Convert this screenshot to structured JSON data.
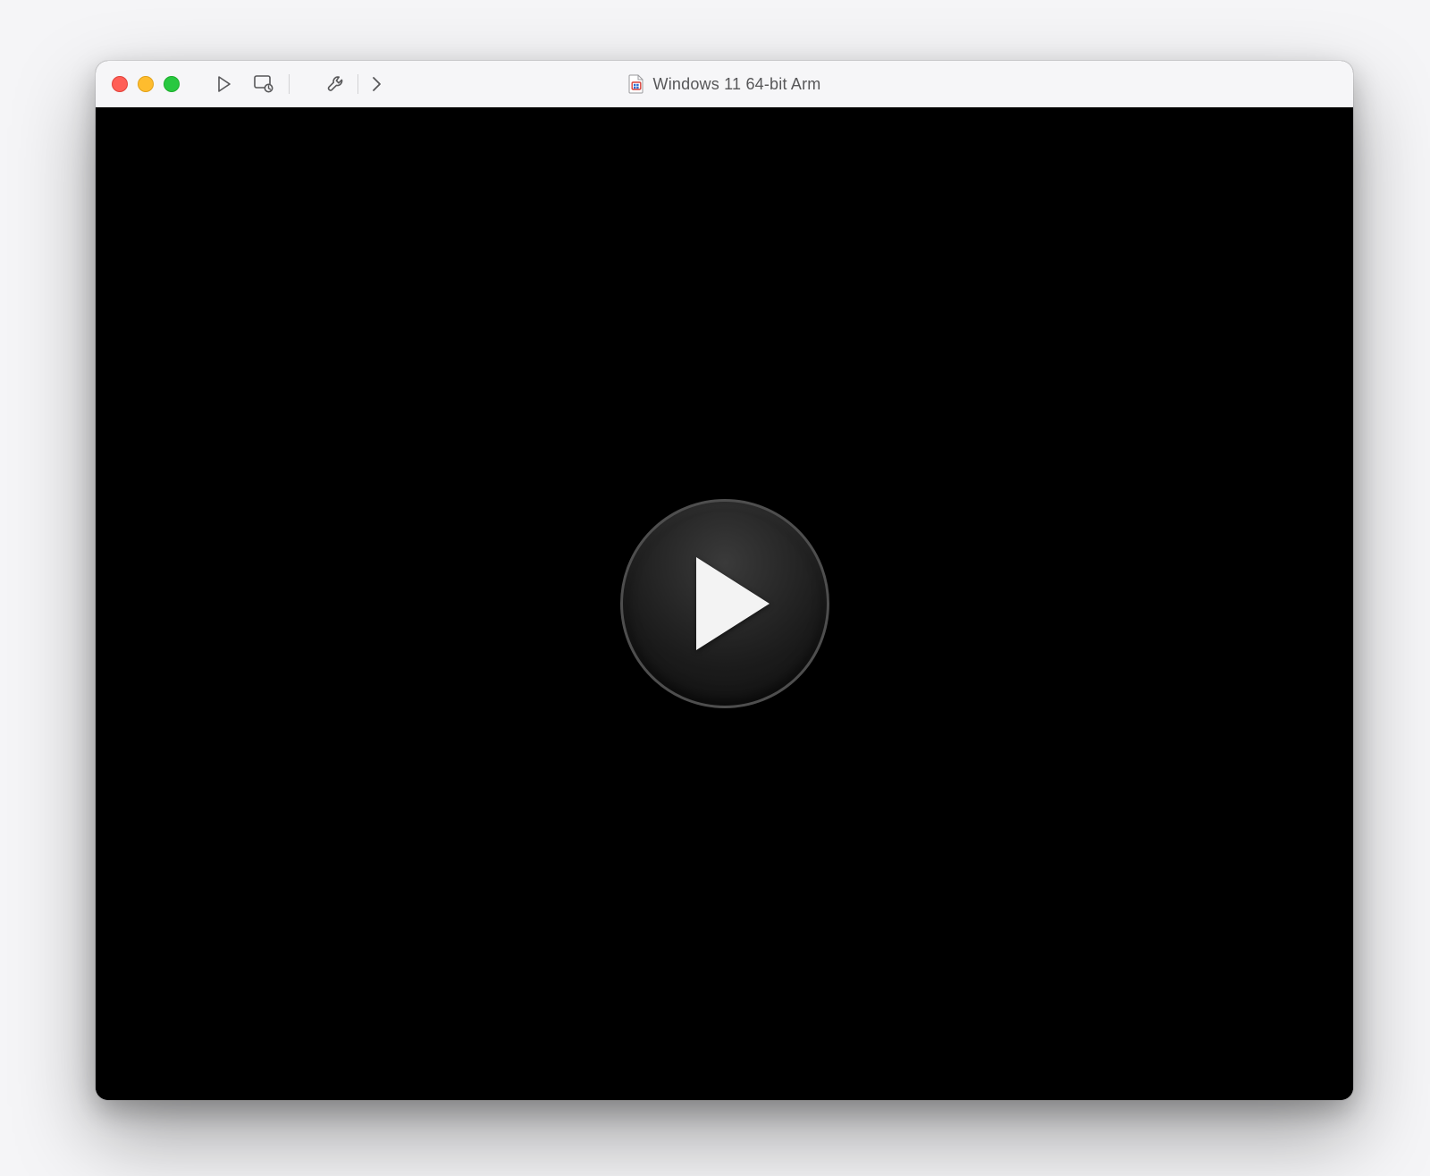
{
  "window": {
    "title": "Windows 11 64-bit Arm"
  },
  "icons": {
    "vm_doc": "vm-document-icon",
    "play": "play-icon",
    "snapshot": "snapshot-icon",
    "settings": "wrench-icon",
    "overflow": "chevron-right-icon",
    "big_play": "big-play-icon"
  },
  "colors": {
    "titlebar_bg": "#f6f6f8",
    "screen_bg": "#000000",
    "icon": "#575759"
  }
}
